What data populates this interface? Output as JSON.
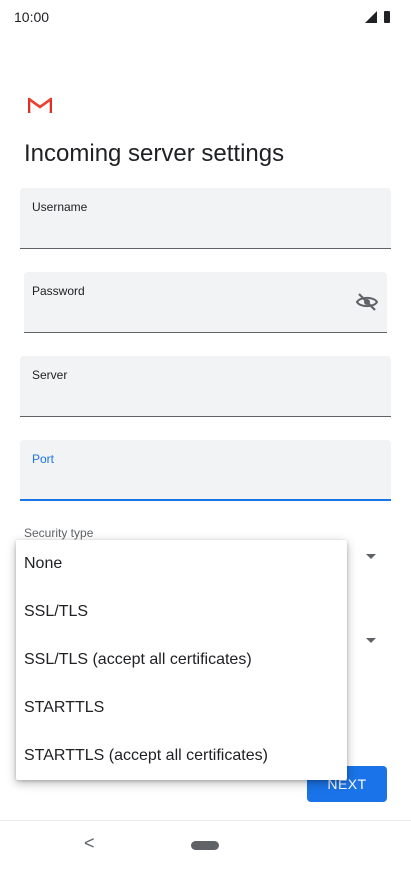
{
  "status_bar": {
    "time": "10:00",
    "signal_icon": "cellular-signal-icon",
    "battery_icon": "battery-icon"
  },
  "header": {
    "logo_icon": "gmail-logo-icon",
    "title": "Incoming server settings"
  },
  "form": {
    "username": {
      "label": "Username",
      "value": ""
    },
    "password": {
      "label": "Password",
      "value": "",
      "toggle_icon": "visibility-off-icon"
    },
    "server": {
      "label": "Server",
      "value": ""
    },
    "port": {
      "label": "Port",
      "value": ""
    },
    "security_type": {
      "label": "Security type"
    }
  },
  "dropdown": {
    "options": [
      "None",
      "SSL/TLS",
      "SSL/TLS (accept all certificates)",
      "STARTTLS",
      "STARTTLS (accept all certificates)"
    ]
  },
  "actions": {
    "next_label": "NEXT"
  },
  "nav": {
    "back_glyph": "<"
  },
  "colors": {
    "accent": "#1a73e8",
    "field_bg": "#f1f3f4",
    "gmail_red": "#d93025"
  }
}
